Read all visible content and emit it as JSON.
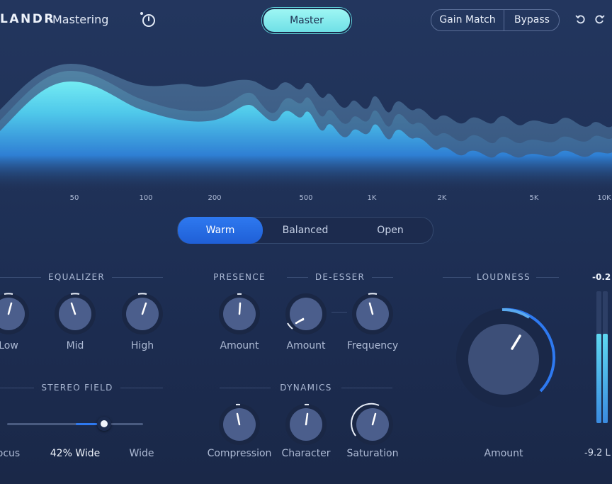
{
  "header": {
    "brand": "LANDR",
    "product": "Mastering",
    "master_label": "Master",
    "gain_match_label": "Gain Match",
    "bypass_label": "Bypass"
  },
  "spectrum": {
    "frequency_ticks": [
      "50",
      "100",
      "200",
      "500",
      "1K",
      "2K",
      "5K",
      "10K"
    ]
  },
  "tone": {
    "options": [
      "Warm",
      "Balanced",
      "Open"
    ],
    "selected": "Warm"
  },
  "equalizer": {
    "title": "EQUALIZER",
    "knobs": [
      "Low",
      "Mid",
      "High"
    ]
  },
  "presence": {
    "title": "PRESENCE",
    "knob": "Amount"
  },
  "deesser": {
    "title": "DE-ESSER",
    "knobs": [
      "Amount",
      "Frequency"
    ]
  },
  "loudness": {
    "title": "LOUDNESS",
    "knob": "Amount",
    "meter_top": "-0.2",
    "meter_bottom": "-9.2 L"
  },
  "stereo": {
    "title": "STEREO FIELD",
    "left_label": "ocus",
    "value": "42% Wide",
    "right_label": "Wide",
    "slider_fraction": 0.42
  },
  "dynamics": {
    "title": "DYNAMICS",
    "knobs": [
      "Compression",
      "Character",
      "Saturation"
    ]
  },
  "colors": {
    "accent": "#2e79f0",
    "master_button": "#8ef0f0",
    "spectrum_fill": "#6ff0f4"
  }
}
